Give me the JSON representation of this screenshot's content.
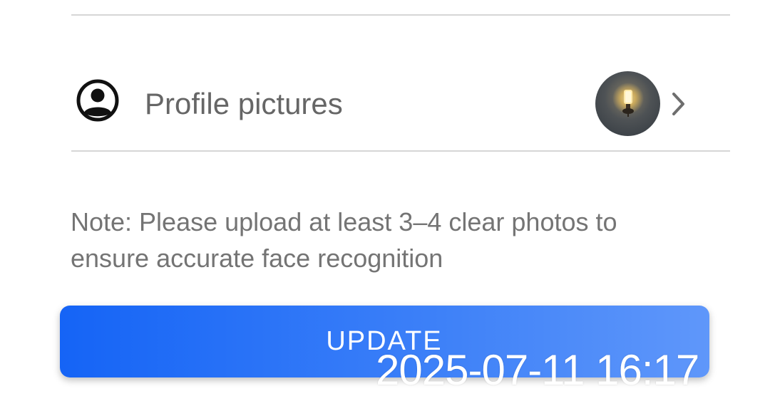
{
  "profile": {
    "label": "Profile pictures",
    "icon": "account-circle-icon",
    "chevron_icon": "chevron-right-icon"
  },
  "note": {
    "text": "Note: Please upload at least 3–4 clear photos to ensure accurate face recognition"
  },
  "update_button": {
    "label": "UPDATE",
    "color_start": "#1564f6",
    "color_end": "#5f97fa"
  },
  "timestamp": "2025-07-11 16:17"
}
